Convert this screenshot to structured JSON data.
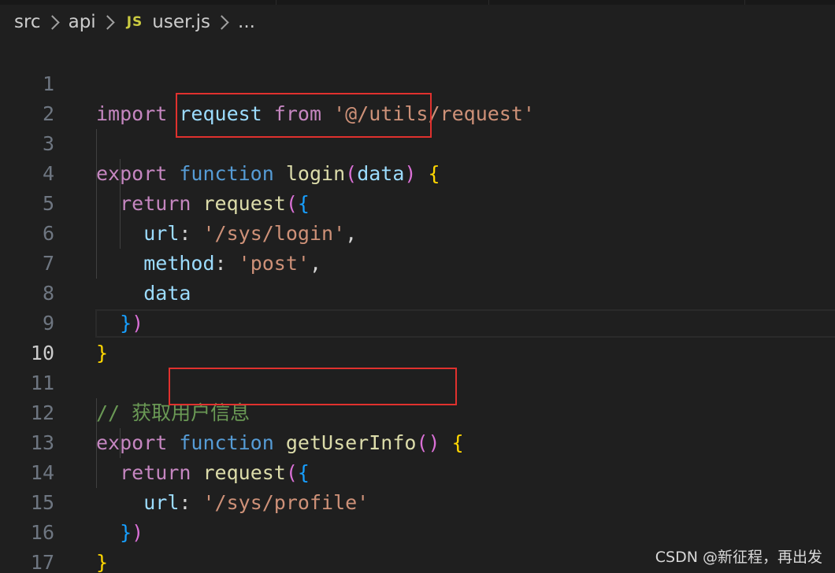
{
  "breadcrumb": {
    "segments": [
      "src",
      "api"
    ],
    "file_icon": "JS",
    "file_name": "user.js",
    "trailing": "..."
  },
  "editor": {
    "current_line": 10,
    "line_numbers": [
      "1",
      "2",
      "3",
      "4",
      "5",
      "6",
      "7",
      "8",
      "9",
      "10",
      "11",
      "12",
      "13",
      "14",
      "15",
      "16",
      "17"
    ],
    "tokens": {
      "import": "import",
      "request": "request",
      "from": "from",
      "import_path": "'@/utils/request'",
      "export": "export",
      "function": "function",
      "login": "login",
      "paren_open": "(",
      "paren_close": ")",
      "data": "data",
      "brace_open": "{",
      "brace_close": "}",
      "return": "return",
      "url_key": "url",
      "colon": ":",
      "comma": ",",
      "login_url": "'/sys/login'",
      "method_key": "method",
      "method_val": "'post'",
      "comment": "// 获取用户信息",
      "getUserInfo": "getUserInfo",
      "profile_url": "'/sys/profile'"
    }
  },
  "watermark": "CSDN @新征程，再出发",
  "colors": {
    "background": "#1f1f1f",
    "keyword_control": "#c586c0",
    "keyword_storage": "#569cd6",
    "variable": "#9cdcfe",
    "function": "#dcdcaa",
    "string": "#ce9178",
    "comment": "#6a9955",
    "bracket_level1": "#ffd700",
    "bracket_level2": "#da70d6",
    "bracket_level3": "#179fff",
    "annotation_box": "#e0312e"
  }
}
